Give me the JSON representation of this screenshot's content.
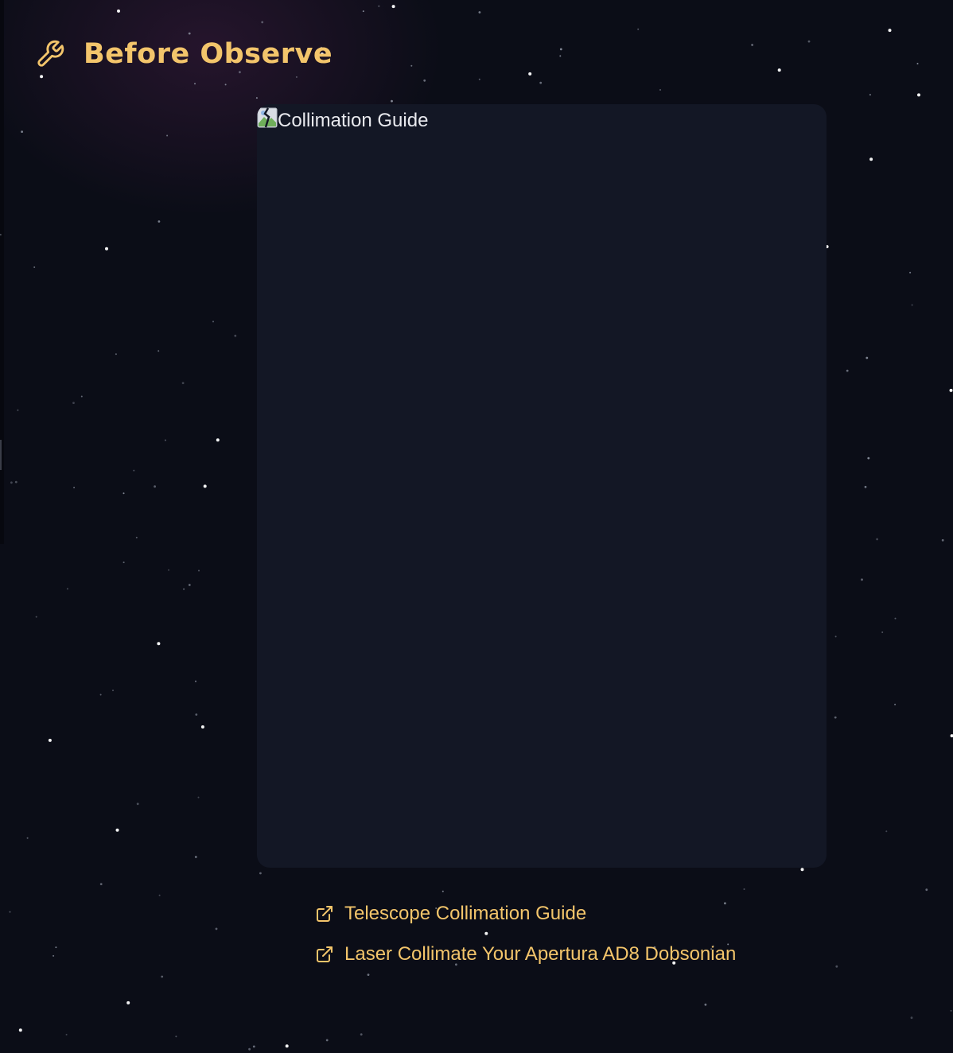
{
  "section": {
    "title": "Before Observe",
    "icon": "wrench-icon"
  },
  "image": {
    "alt": "Collimation Guide",
    "icon": "broken-image-icon"
  },
  "links": [
    {
      "label": "Telescope Collimation Guide",
      "icon": "external-link-icon"
    },
    {
      "label": "Laser Collimate Your Apertura AD8 Dobsonian",
      "icon": "external-link-icon"
    }
  ],
  "colors": {
    "accent": "#f3c56b",
    "background": "#0b0d17",
    "card": "#131725",
    "text": "#e8e9ee"
  }
}
